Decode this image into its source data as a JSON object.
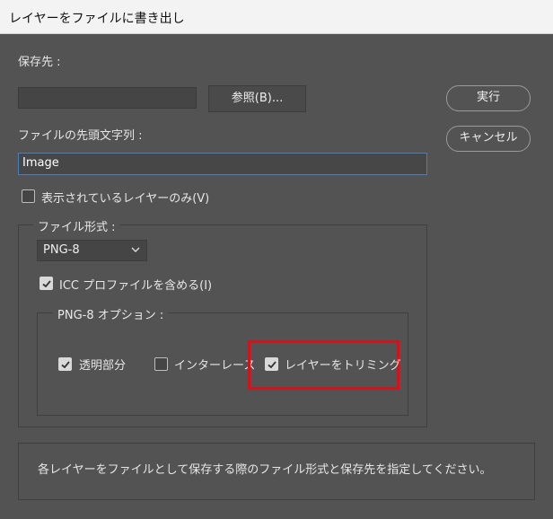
{
  "window": {
    "title": "レイヤーをファイルに書き出し"
  },
  "destination": {
    "label": "保存先 :",
    "value": "",
    "browse_label": "参照(B)..."
  },
  "prefix": {
    "label": "ファイルの先頭文字列 :",
    "value": "Image"
  },
  "visible_only": {
    "label": "表示されているレイヤーのみ(V)",
    "checked": false
  },
  "file_format": {
    "legend": "ファイル形式 :",
    "selected": "PNG-8",
    "icc": {
      "label": "ICC プロファイルを含める(I)",
      "checked": true
    }
  },
  "png8_options": {
    "legend": "PNG-8 オプション :",
    "transparency": {
      "label": "透明部分",
      "checked": true
    },
    "interlace": {
      "label": "インターレース",
      "checked": false
    },
    "trim": {
      "label": "レイヤーをトリミング",
      "checked": true
    }
  },
  "buttons": {
    "run": "実行",
    "cancel": "キャンセル"
  },
  "description": "各レイヤーをファイルとして保存する際のファイル形式と保存先を指定してください。",
  "colors": {
    "highlight": "#d0141b",
    "focus": "#4a7fbf"
  }
}
